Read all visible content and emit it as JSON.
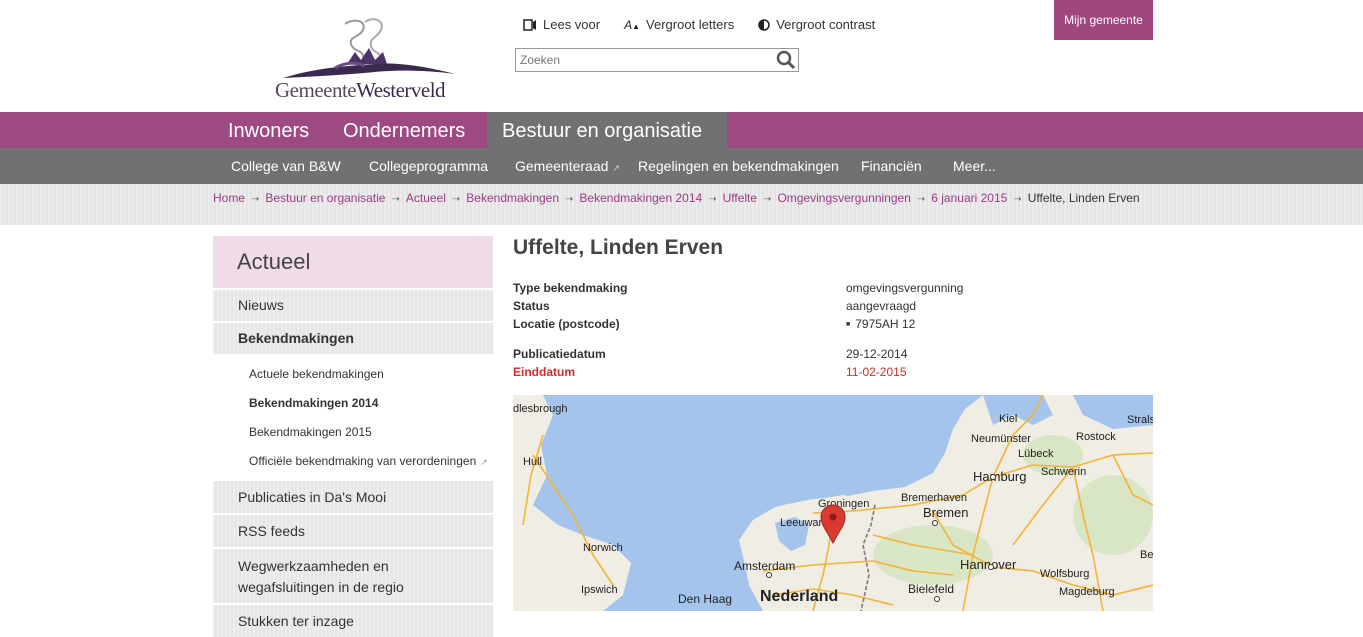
{
  "header": {
    "logo_text_1": "Gemeente",
    "logo_text_2": "Westerveld",
    "tools": [
      {
        "icon": "speaker-icon",
        "label": "Lees voor"
      },
      {
        "icon": "text-size-icon",
        "label": "Vergroot letters"
      },
      {
        "icon": "contrast-icon",
        "label": "Vergroot contrast"
      }
    ],
    "search_placeholder": "Zoeken",
    "mijn_label": "Mijn gemeente"
  },
  "mainnav": [
    "Inwoners",
    "Ondernemers",
    "Bestuur en organisatie"
  ],
  "subnav": [
    "College van B&W",
    "Collegeprogramma",
    "Gemeenteraad",
    "Regelingen en bekendmakingen",
    "Financiën",
    "Meer..."
  ],
  "breadcrumb": [
    "Home",
    "Bestuur en organisatie",
    "Actueel",
    "Bekendmakingen",
    "Bekendmakingen 2014",
    "Uffelte",
    "Omgevingsvergunningen",
    "6 januari 2015",
    "Uffelte, Linden Erven"
  ],
  "sidebar": {
    "title": "Actueel",
    "items": [
      {
        "label": "Nieuws"
      },
      {
        "label": "Bekendmakingen"
      }
    ],
    "subitems": [
      "Actuele bekendmakingen",
      "Bekendmakingen 2014",
      "Bekendmakingen 2015",
      "Officiële bekendmaking van verordeningen"
    ],
    "items_after": [
      "Publicaties in Da's Mooi",
      "RSS feeds",
      "Wegwerkzaamheden en wegafsluitingen in de regio",
      "Stukken ter inzage"
    ]
  },
  "content": {
    "title": "Uffelte, Linden Erven",
    "details": [
      {
        "key": "Type bekendmaking",
        "value": "omgevingsvergunning"
      },
      {
        "key": "Status",
        "value": "aangevraagd"
      },
      {
        "key": "Locatie (postcode)",
        "value": "7975AH 12"
      },
      {
        "key": "Publicatiedatum",
        "value": "29-12-2014"
      },
      {
        "key": "Einddatum",
        "value": "11-02-2015"
      }
    ]
  },
  "map": {
    "labels": [
      "dlesbrough",
      "Kiel",
      "Stralsu",
      "Neumünster",
      "Rostock",
      "Lübeck",
      "Hull",
      "Hamburg",
      "Schwerin",
      "Groningen",
      "Bremerhaven",
      "Leeuwarden",
      "Bremen",
      "Norwich",
      "Amsterdam",
      "Hannover",
      "Wolfsburg",
      "Be",
      "Ipswich",
      "Bielefeld",
      "Magdeburg",
      "Den Haag",
      "Nederland"
    ],
    "colors": {
      "sea": "#a4c4ec",
      "land": "#f0ede5",
      "road": "#f5b335",
      "marker": "#d93a32"
    }
  },
  "colors": {
    "brand": "#9e4a82",
    "subnav": "#6f7173",
    "link": "#9e3a83",
    "alert": "#d42c2c"
  }
}
